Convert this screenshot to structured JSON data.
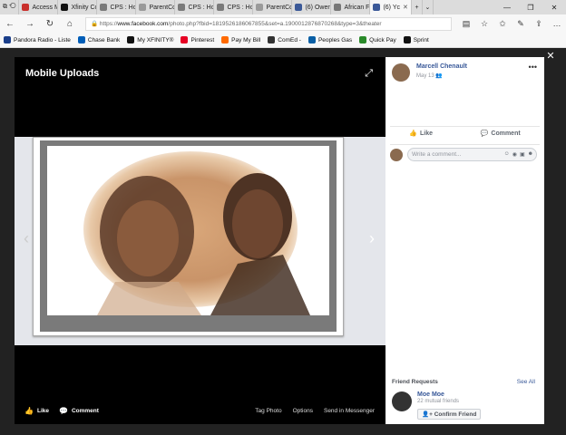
{
  "browser": {
    "tabs": [
      {
        "label": "Access M",
        "color": "#c9302c"
      },
      {
        "label": "Xfinity Cc",
        "color": "#111111"
      },
      {
        "label": "CPS : Hor",
        "color": "#7a7a7a"
      },
      {
        "label": "ParentCo",
        "color": "#9a9a9a"
      },
      {
        "label": "CPS : Hor",
        "color": "#7a7a7a"
      },
      {
        "label": "CPS : Hor",
        "color": "#7a7a7a"
      },
      {
        "label": "ParentCo",
        "color": "#9a9a9a"
      },
      {
        "label": "(6) Owen",
        "color": "#3b5998"
      },
      {
        "label": "African Fe",
        "color": "#777777"
      },
      {
        "label": "(6) Yc",
        "color": "#3b5998",
        "active": true
      }
    ],
    "url_prefix": "https://",
    "url_domain": "www.facebook.com",
    "url_rest": "/photo.php?fbid=1819526186067855&set=a.1900012876870268&type=3&theater",
    "bookmarks": [
      {
        "label": "Pandora Radio - Liste",
        "color": "#1a3e8a"
      },
      {
        "label": "Chase Bank",
        "color": "#005eb8"
      },
      {
        "label": "My XFINITY®",
        "color": "#111111"
      },
      {
        "label": "Pinterest",
        "color": "#e60023"
      },
      {
        "label": "Pay My Bill",
        "color": "#ff6a00"
      },
      {
        "label": "ComEd -",
        "color": "#333333"
      },
      {
        "label": "Peoples Gas",
        "color": "#0a5fa5"
      },
      {
        "label": "Quick Pay",
        "color": "#2a8a2a"
      },
      {
        "label": "Sprint",
        "color": "#111111"
      }
    ]
  },
  "viewer": {
    "album_title": "Mobile Uploads",
    "like_label": "Like",
    "comment_label": "Comment",
    "tag_photo": "Tag Photo",
    "options": "Options",
    "send": "Send in Messenger"
  },
  "post": {
    "author": "Marcell Chenault",
    "date": "May 13",
    "like_label": "Like",
    "comment_label": "Comment",
    "comment_placeholder": "Write a comment..."
  },
  "friend_requests": {
    "title": "Friend Requests",
    "see_all": "See All",
    "name": "Moe Moe",
    "mutual": "22 mutual friends",
    "confirm": "Confirm Friend"
  }
}
